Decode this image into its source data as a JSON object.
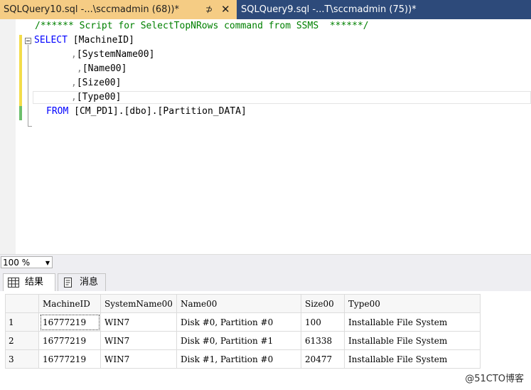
{
  "tabs": {
    "active": {
      "title": "SQLQuery10.sql -...\\sccmadmin (68))*",
      "pin": "⊅",
      "close": "✕"
    },
    "inactive": {
      "title": "SQLQuery9.sql -...T\\sccmadmin (75))*"
    }
  },
  "editor": {
    "comment": "/****** Script for SelectTopNRows command from SSMS  ******/",
    "select_kw": "SELECT",
    "from_kw": "FROM",
    "columns": [
      "[MachineID]",
      "[SystemName00]",
      "[Name00]",
      "[Size00]",
      "[Type00]"
    ],
    "table": "[CM_PD1].[dbo].[Partition_DATA]"
  },
  "zoom": {
    "value": "100 %"
  },
  "results_tabs": {
    "results_label": "结果",
    "messages_label": "消息"
  },
  "grid": {
    "headers": [
      "MachineID",
      "SystemName00",
      "Name00",
      "Size00",
      "Type00"
    ],
    "rows": [
      {
        "n": "1",
        "cells": [
          "16777219",
          "WIN7",
          "Disk #0, Partition #0",
          "100",
          "Installable File System"
        ]
      },
      {
        "n": "2",
        "cells": [
          "16777219",
          "WIN7",
          "Disk #0, Partition #1",
          "61338",
          "Installable File System"
        ]
      },
      {
        "n": "3",
        "cells": [
          "16777219",
          "WIN7",
          "Disk #1, Partition #0",
          "20477",
          "Installable File System"
        ]
      }
    ]
  },
  "watermark": "@51CTO博客"
}
